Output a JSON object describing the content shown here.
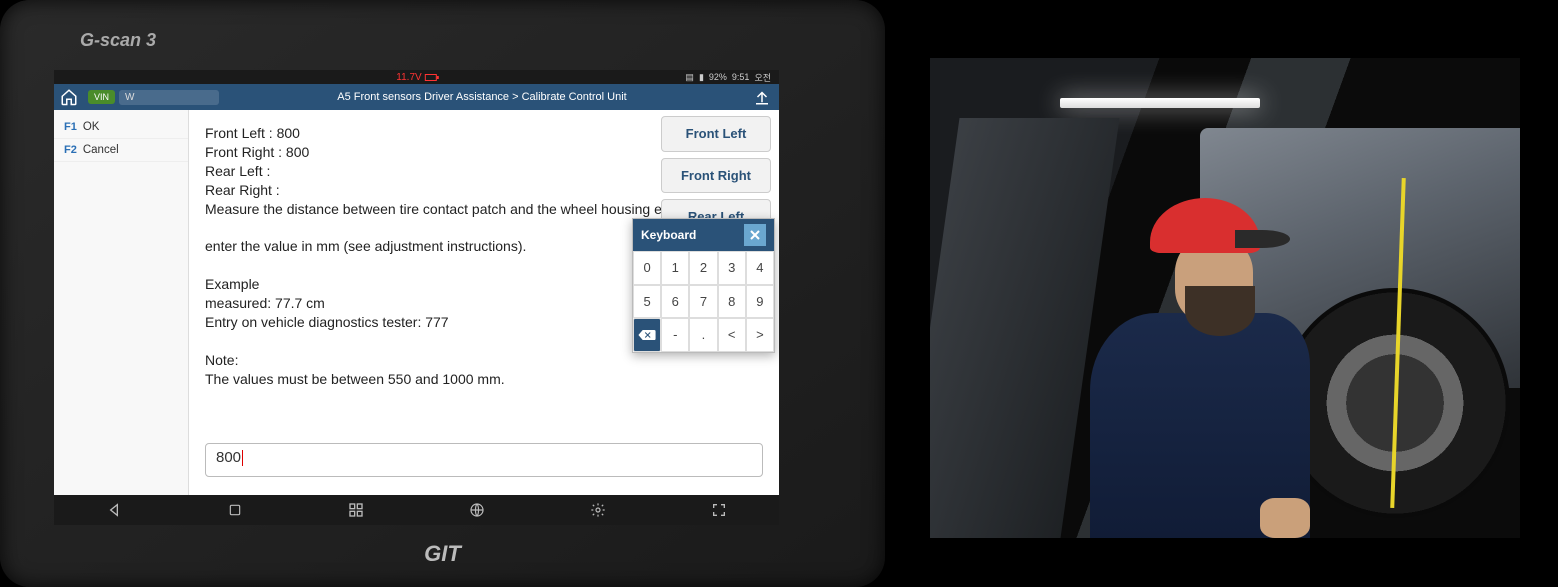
{
  "device": {
    "brand_top": "G-scan 3",
    "brand_bottom": "GIT"
  },
  "status_bar": {
    "voltage": "11.7V",
    "battery_pct": "92%",
    "time": "9:51",
    "ampm": "오전"
  },
  "header": {
    "vin_chip": "VIN",
    "vin_value": "W",
    "breadcrumb": "A5 Front sensors Driver Assistance  >  Calibrate Control Unit"
  },
  "sidebar": {
    "items": [
      {
        "fkey": "F1",
        "label": "OK"
      },
      {
        "fkey": "F2",
        "label": "Cancel"
      }
    ]
  },
  "content": {
    "lines": [
      "Front Left : 800",
      "Front Right : 800",
      "Rear Left :",
      "Rear Right :",
      "Measure the distance between tire contact patch and the wheel housing edge",
      "",
      "enter the value in mm (see adjustment instructions).",
      "",
      "Example",
      "measured: 77.7 cm",
      "Entry on vehicle diagnostics tester: 777",
      "",
      "Note:",
      "The values must be between 550 and 1000 mm."
    ],
    "input_value": "800"
  },
  "right_panel": {
    "buttons": [
      "Front Left",
      "Front Right",
      "Rear Left"
    ]
  },
  "keyboard": {
    "title": "Keyboard",
    "keys_row1": [
      "0",
      "1",
      "2",
      "3",
      "4"
    ],
    "keys_row2": [
      "5",
      "6",
      "7",
      "8",
      "9"
    ],
    "keys_row3": [
      "⌫",
      "-",
      ".",
      "<",
      ">"
    ]
  }
}
